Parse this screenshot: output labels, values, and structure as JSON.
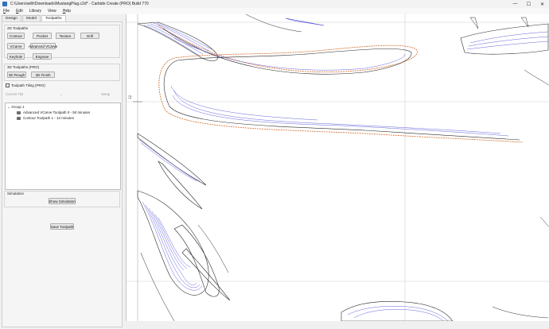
{
  "window": {
    "title": "C:\\Users\\willr\\Downloads\\MustangPlug.c2d* - Carbide Create (PRO) Build 770",
    "controls": {
      "minimize": "—",
      "maximize": "☐",
      "close": "✕"
    }
  },
  "menu": [
    {
      "key": "F",
      "rest": "ile"
    },
    {
      "key": "E",
      "rest": "dit"
    },
    {
      "key": "",
      "rest": "Library"
    },
    {
      "key": "",
      "rest": "View"
    },
    {
      "key": "H",
      "rest": "elp"
    }
  ],
  "tabs": [
    "Design",
    "Model",
    "Toolpaths"
  ],
  "active_tab": "Toolpaths",
  "toolpaths_2d": {
    "title": "2D Toolpaths",
    "buttons": [
      "Contour",
      "Pocket",
      "Texture",
      "Drill",
      "VCarve",
      "Advanced VCarve",
      "Keyhole",
      "Engrave"
    ]
  },
  "toolpaths_3d": {
    "title": "3D Toolpaths (PRO)",
    "buttons": [
      "3D Rough",
      "3D Finish"
    ]
  },
  "tiling": {
    "label": "Toolpath Tiling (PRO)",
    "checked": false
  },
  "current_tile": {
    "label": "Current Tile",
    "setup": "Setup"
  },
  "tree": {
    "group": "Group 1",
    "items": [
      "Advanced VCarve Toolpath 0 - 50 minutes",
      "Contour Toolpath 1 - 12 minutes"
    ]
  },
  "simulation": {
    "title": "Simulation",
    "button": "Show Simulation"
  },
  "save_button": "Save Toolpath",
  "ruler": {
    "mark": "12"
  },
  "colors": {
    "toolpath_vcarve": "#3c3cd2",
    "toolpath_contour": "#d46a2a",
    "outline": "#2a2a2a",
    "grid": "#cfcfcf"
  }
}
